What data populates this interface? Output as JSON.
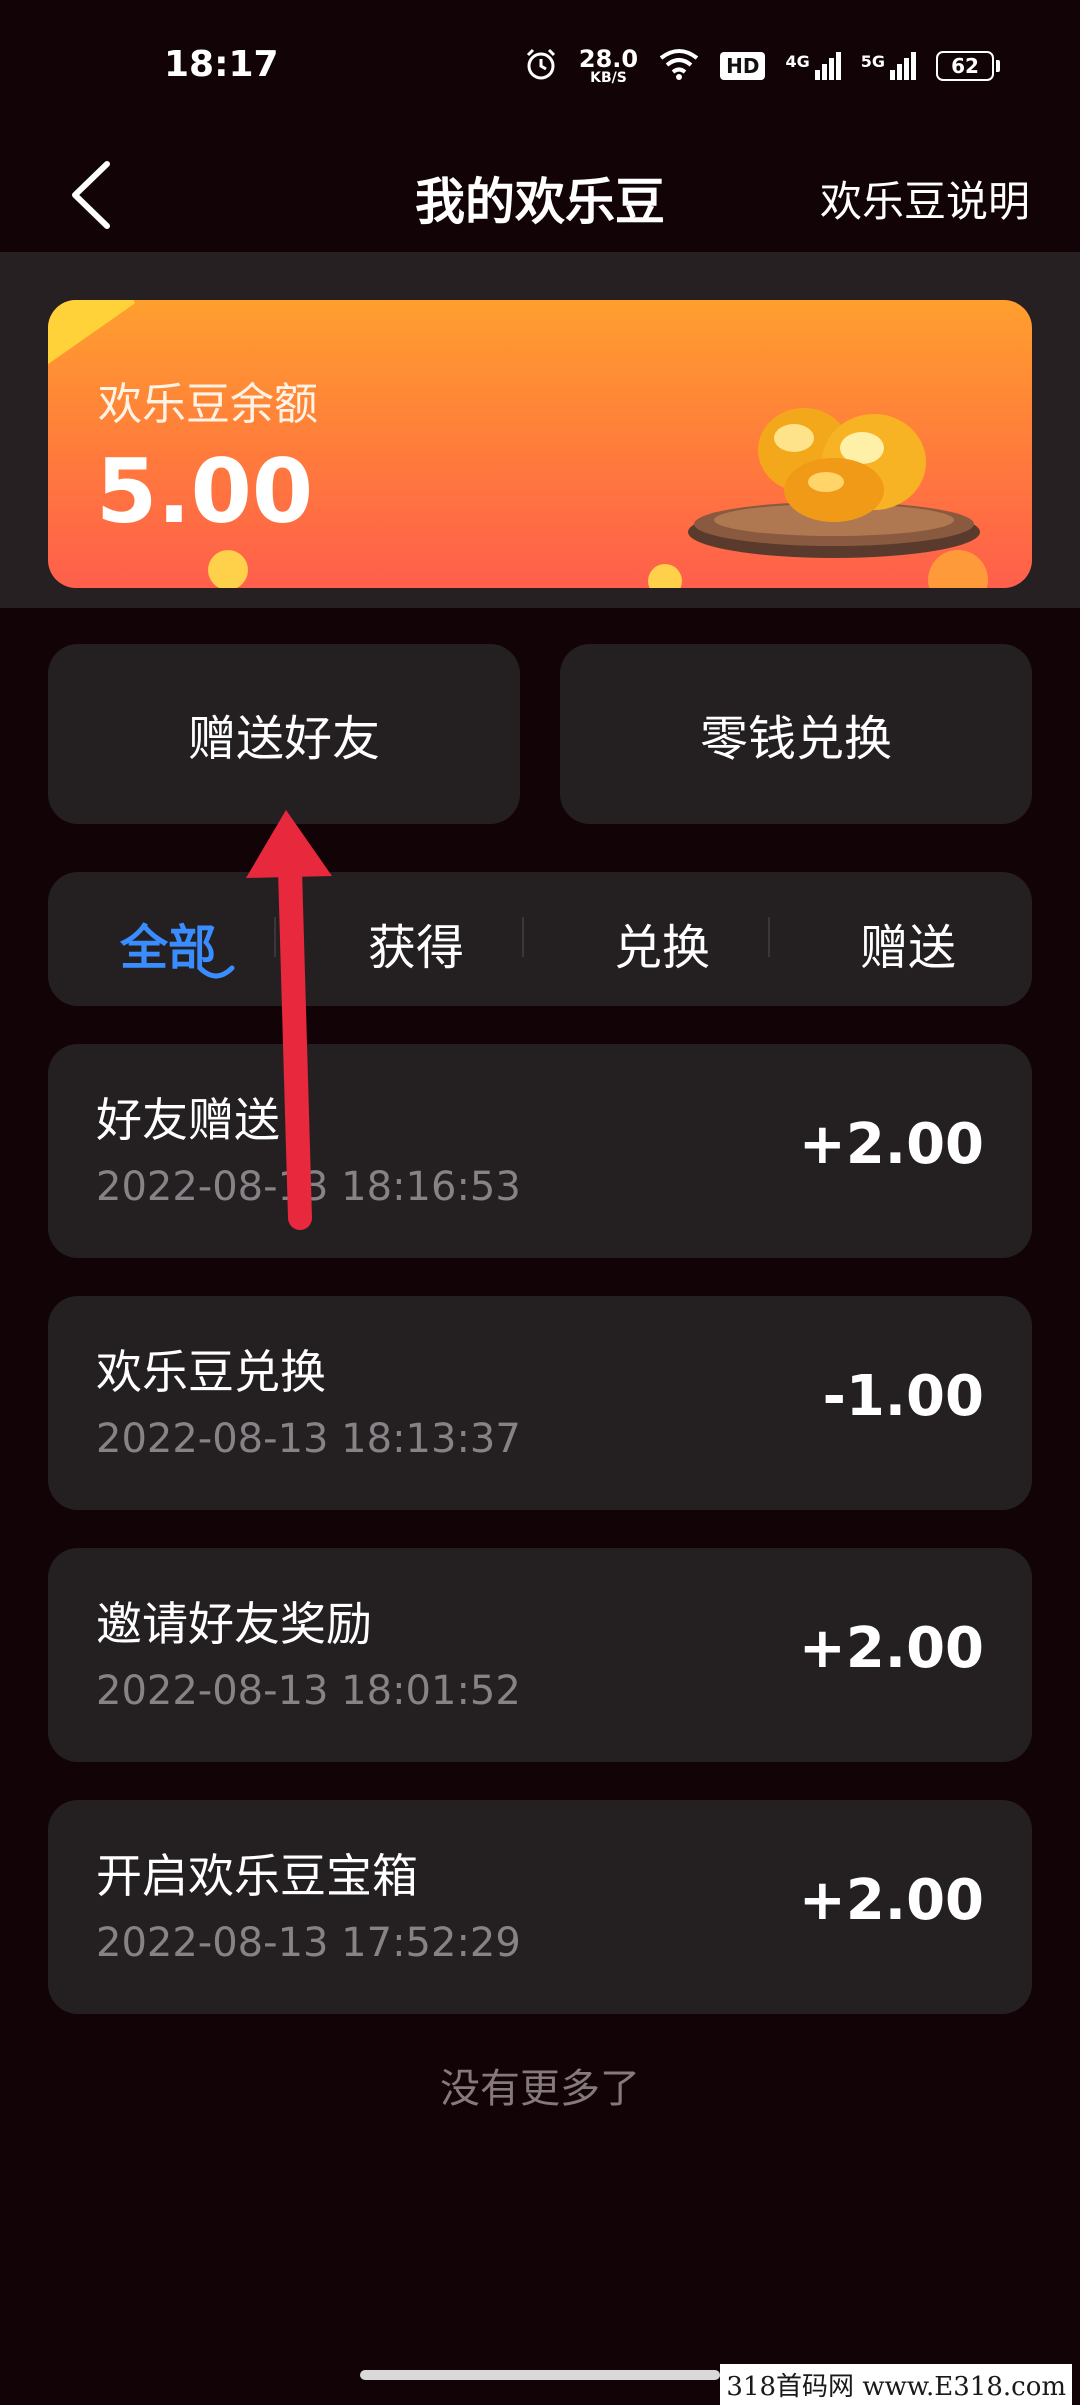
{
  "status_bar": {
    "time": "18:17",
    "net_speed_value": "28.0",
    "net_speed_unit": "KB/S",
    "hd_badge": "HD",
    "sim1_label": "4G",
    "sim2_label": "5G",
    "battery": "62"
  },
  "header": {
    "title": "我的欢乐豆",
    "help_link": "欢乐豆说明"
  },
  "balance": {
    "label": "欢乐豆余额",
    "value": "5.00"
  },
  "actions": {
    "gift": "赠送好友",
    "exchange": "零钱兑换"
  },
  "tabs": [
    {
      "label": "全部",
      "active": true
    },
    {
      "label": "获得",
      "active": false
    },
    {
      "label": "兑换",
      "active": false
    },
    {
      "label": "赠送",
      "active": false
    }
  ],
  "records": [
    {
      "title": "好友赠送",
      "time": "2022-08-13 18:16:53",
      "amount": "+2.00"
    },
    {
      "title": "欢乐豆兑换",
      "time": "2022-08-13 18:13:37",
      "amount": "-1.00"
    },
    {
      "title": "邀请好友奖励",
      "time": "2022-08-13 18:01:52",
      "amount": "+2.00"
    },
    {
      "title": "开启欢乐豆宝箱",
      "time": "2022-08-13 17:52:29",
      "amount": "+2.00"
    }
  ],
  "footer": {
    "no_more": "没有更多了"
  },
  "watermark": "318首码网 www.E318.com",
  "colors": {
    "background": "#120406",
    "card": "#242022",
    "accent_tab": "#3a8dff",
    "annotation_arrow": "#e8283c",
    "balance_card_top": "#ff9f2e",
    "balance_card_bottom": "#ff5f4c"
  },
  "icons": {
    "back": "chevron-left-icon",
    "wifi": "wifi-icon",
    "alarm": "alarm-icon",
    "beans": "golden-beans-illustration"
  }
}
